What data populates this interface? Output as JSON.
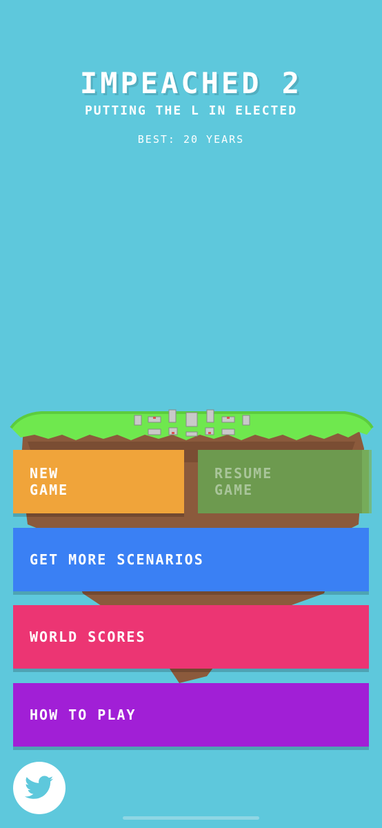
{
  "header": {
    "title": "IMPEACHED 2",
    "subtitle": "PUTTING THE L IN ELECTED",
    "best": "BEST: 20 YEARS"
  },
  "menu": {
    "new_game": "NEW\nGAME",
    "resume_game": "RESUME\nGAME",
    "get_more_scenarios": "GET MORE SCENARIOS",
    "world_scores": "WORLD SCORES",
    "how_to_play": "HOW TO PLAY"
  },
  "icons": {
    "twitter": "twitter-bird-icon"
  },
  "colors": {
    "background": "#5ec8dc",
    "new_game": "#f0a43a",
    "resume_game_disabled": "#6d9a4f",
    "get_more_scenarios": "#3a80f4",
    "world_scores": "#ec3573",
    "how_to_play": "#a11fd6",
    "grass": "#6fe84e",
    "dirt": "#8b5a3c"
  }
}
